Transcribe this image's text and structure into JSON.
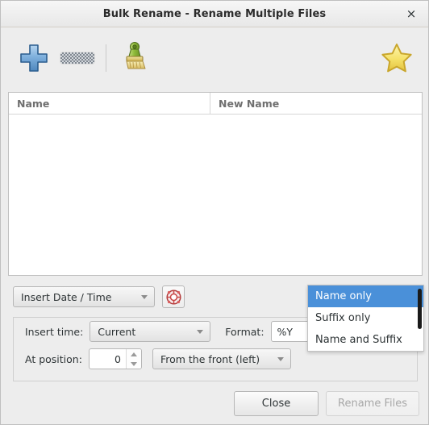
{
  "window": {
    "title": "Bulk Rename - Rename Multiple Files",
    "close_icon": "close-icon",
    "close_glyph": "×"
  },
  "toolbar": {
    "add_icon": "plus-icon",
    "add_tooltip": "Add Files",
    "remove_icon": "minus-icon",
    "remove_tooltip": "Remove Files",
    "remove_enabled": "false",
    "clear_icon": "paintbrush-icon",
    "clear_tooltip": "Clear",
    "favorite_icon": "star-icon",
    "favorite_tooltip": "Favorites"
  },
  "filelist": {
    "columns": [
      "Name",
      "New Name"
    ],
    "rows": []
  },
  "criteria": {
    "selected": "Insert Date / Time",
    "help_icon": "lifebuoy-icon"
  },
  "fields": {
    "insert_time_label": "Insert time:",
    "insert_time_value": "Current",
    "format_label": "Format:",
    "format_value": "%Y",
    "at_position_label": "At position:",
    "at_position_value": "0",
    "direction_value": "From the front (left)"
  },
  "popup_menu": {
    "items": [
      {
        "label": "Name only",
        "selected": true
      },
      {
        "label": "Suffix only",
        "selected": false
      },
      {
        "label": "Name and Suffix",
        "selected": false
      }
    ],
    "scrollbar": "vertical-scrollbar"
  },
  "actions": {
    "close_label": "Close",
    "rename_label": "Rename Files",
    "rename_enabled": "false"
  },
  "colors": {
    "accent": "#4a90d9",
    "window_bg": "#ededed",
    "list_bg": "#ffffff",
    "text": "#2e3436",
    "header_text": "#6f6f6f",
    "disabled_text": "#a7a7a7"
  }
}
